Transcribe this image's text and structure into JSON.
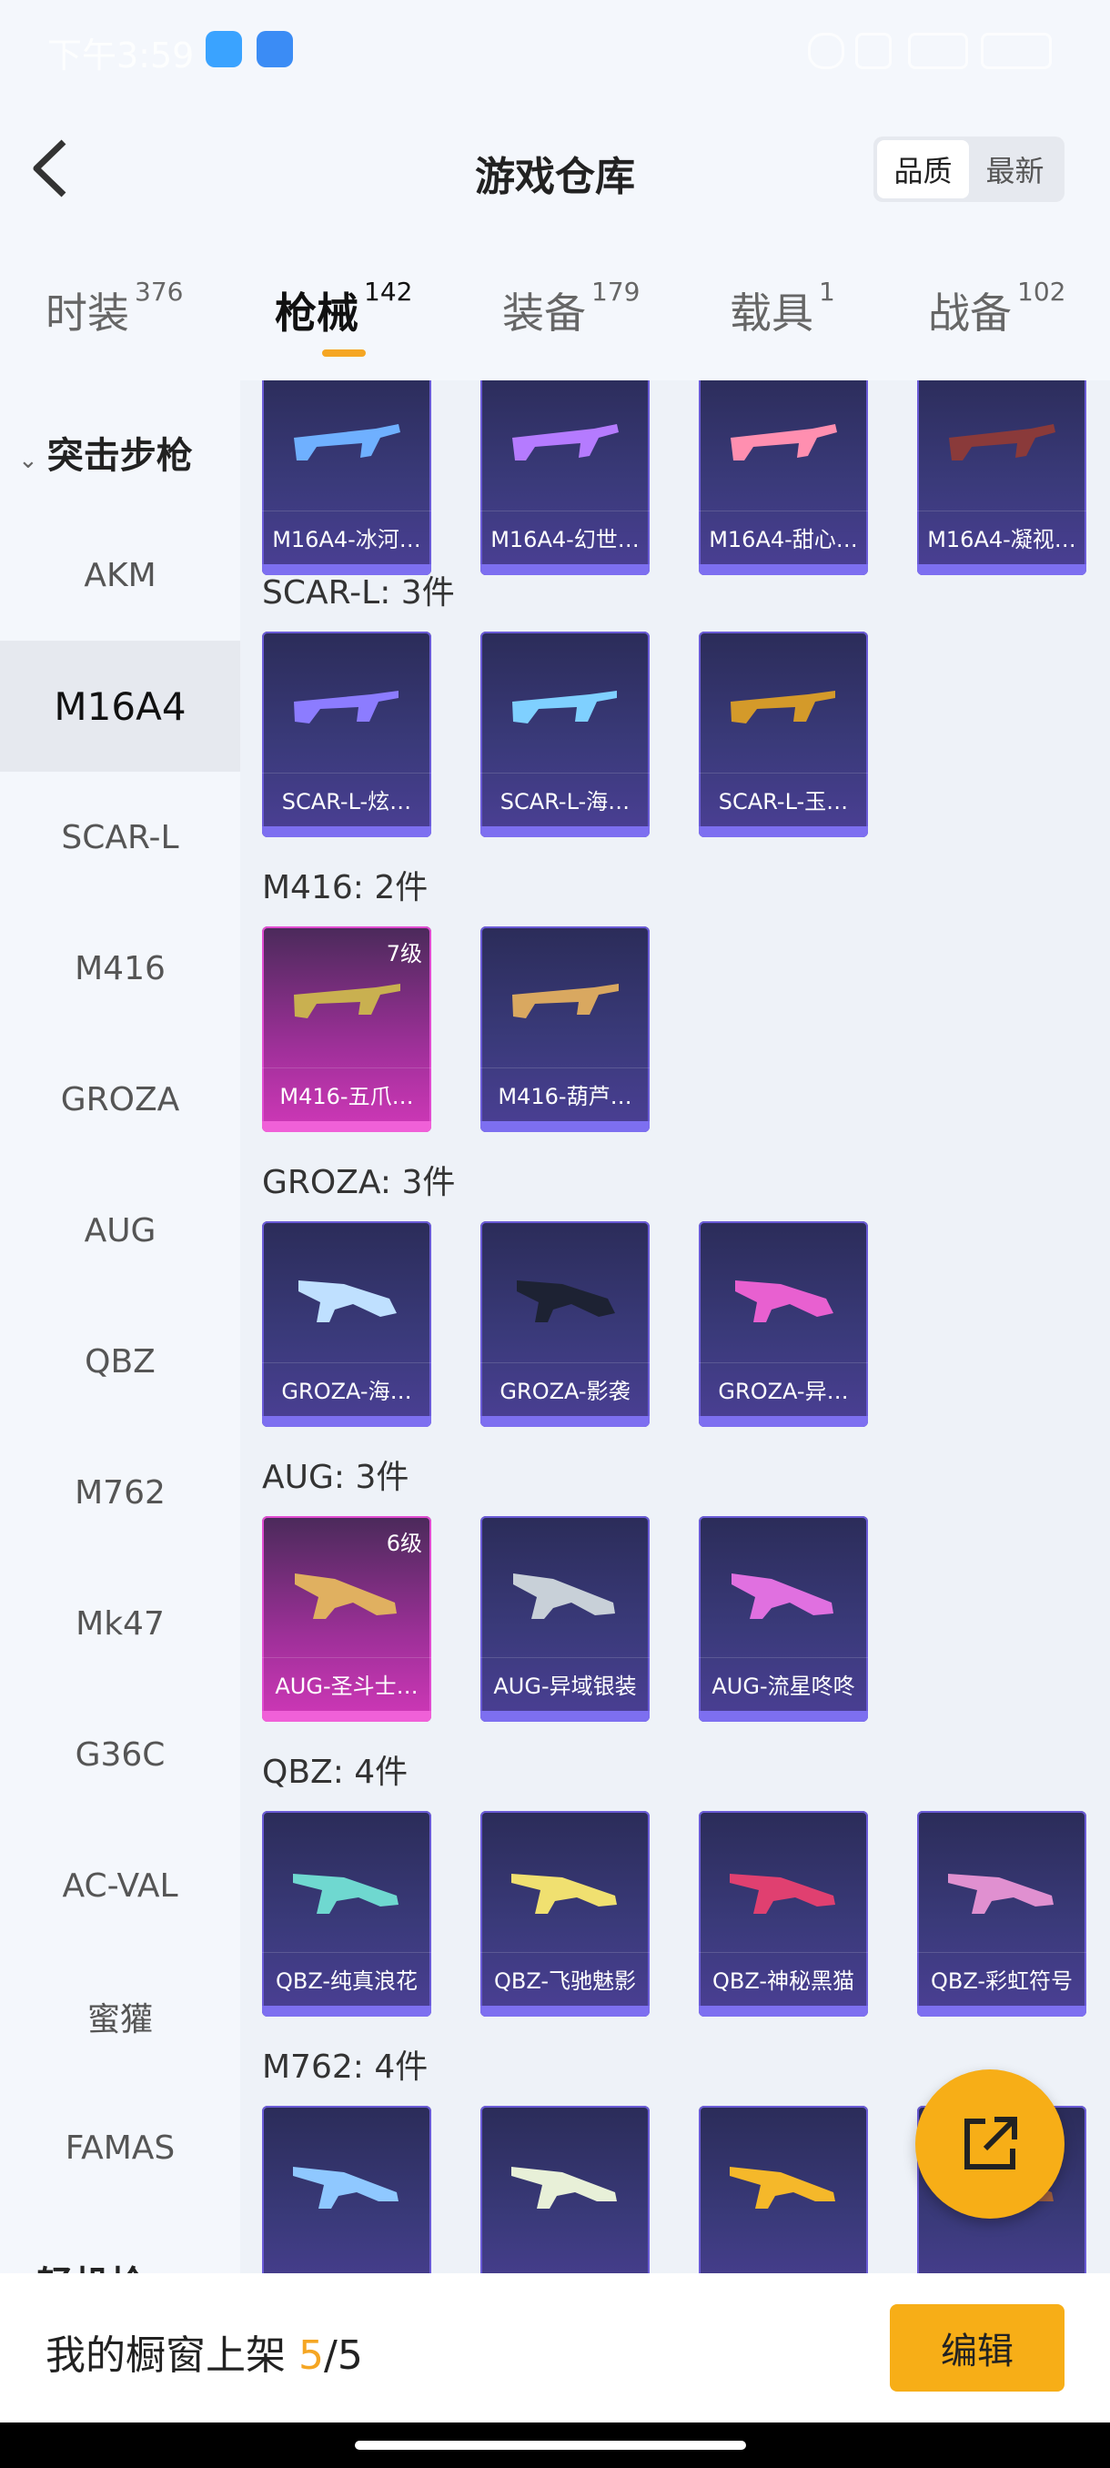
{
  "status": {
    "time": "下午3:59"
  },
  "header": {
    "title": "游戏仓库",
    "sort_quality": "品质",
    "sort_newest": "最新"
  },
  "tabs": [
    {
      "label": "时装",
      "count": "376"
    },
    {
      "label": "枪械",
      "count": "142"
    },
    {
      "label": "装备",
      "count": "179"
    },
    {
      "label": "载具",
      "count": "1"
    },
    {
      "label": "战备",
      "count": "102"
    }
  ],
  "sidebar": {
    "group": "突击步枪",
    "items": [
      "AKM",
      "M16A4",
      "SCAR-L",
      "M416",
      "GROZA",
      "AUG",
      "QBZ",
      "M762",
      "Mk47",
      "G36C",
      "AC-VAL",
      "蜜獾",
      "FAMAS"
    ],
    "partial": "轻机枪"
  },
  "sections": [
    {
      "label": "",
      "items": [
        {
          "name": "M16A4-冰河…"
        },
        {
          "name": "M16A4-幻世…"
        },
        {
          "name": "M16A4-甜心…"
        },
        {
          "name": "M16A4-凝视…"
        }
      ]
    },
    {
      "label": "SCAR-L: 3件",
      "items": [
        {
          "name": "SCAR-L-炫…"
        },
        {
          "name": "SCAR-L-海…"
        },
        {
          "name": "SCAR-L-玉…"
        }
      ]
    },
    {
      "label": "M416: 2件",
      "items": [
        {
          "name": "M416-五爪…",
          "level": "7级"
        },
        {
          "name": "M416-葫芦…"
        }
      ]
    },
    {
      "label": "GROZA: 3件",
      "items": [
        {
          "name": "GROZA-海…"
        },
        {
          "name": "GROZA-影袭"
        },
        {
          "name": "GROZA-异…"
        }
      ]
    },
    {
      "label": "AUG: 3件",
      "items": [
        {
          "name": "AUG-圣斗士…",
          "level": "6级"
        },
        {
          "name": "AUG-异域银装"
        },
        {
          "name": "AUG-流星咚咚"
        }
      ]
    },
    {
      "label": "QBZ: 4件",
      "items": [
        {
          "name": "QBZ-纯真浪花"
        },
        {
          "name": "QBZ-飞驰魅影"
        },
        {
          "name": "QBZ-神秘黑猫"
        },
        {
          "name": "QBZ-彩虹符号"
        }
      ]
    },
    {
      "label": "M762: 4件",
      "items": [
        {
          "name": ""
        },
        {
          "name": ""
        },
        {
          "name": ""
        },
        {
          "name": ""
        }
      ]
    }
  ],
  "bottom": {
    "shelf_label": "我的橱窗上架",
    "shelf_current": "5",
    "shelf_total": "/5",
    "edit_label": "编辑"
  },
  "colors": {
    "accent": "#f7ae17",
    "card_purple": "#3a3a7a",
    "card_pink": "#d038b8"
  }
}
